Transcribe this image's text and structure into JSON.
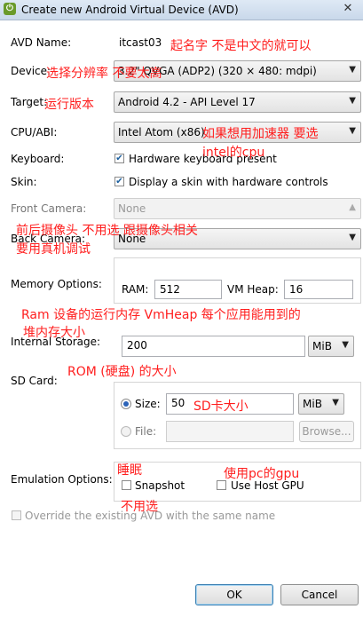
{
  "window": {
    "title": "Create new Android Virtual Device (AVD)",
    "close_glyph": "✕"
  },
  "avd_name": {
    "label": "AVD Name:",
    "value": "itcast03"
  },
  "device": {
    "label": "Device:",
    "value": "3.2\" QVGA (ADP2) (320 × 480: mdpi)"
  },
  "target": {
    "label": "Target:",
    "value": "Android 4.2 - API Level 17"
  },
  "cpu_abi": {
    "label": "CPU/ABI:",
    "value": "Intel Atom (x86)"
  },
  "keyboard": {
    "label": "Keyboard:",
    "checkbox_label": "Hardware keyboard present",
    "checked": true
  },
  "skin": {
    "label": "Skin:",
    "checkbox_label": "Display a skin with hardware controls",
    "checked": true
  },
  "front_camera": {
    "label": "Front Camera:",
    "value": "None"
  },
  "back_camera": {
    "label": "Back Camera:",
    "value": "None"
  },
  "memory": {
    "label": "Memory Options:",
    "ram_label": "RAM:",
    "ram_value": "512",
    "vmheap_label": "VM Heap:",
    "vmheap_value": "16"
  },
  "internal_storage": {
    "label": "Internal Storage:",
    "value": "200",
    "unit": "MiB"
  },
  "sd_card": {
    "label": "SD Card:",
    "size_label": "Size:",
    "size_value": "50",
    "size_unit": "MiB",
    "file_label": "File:",
    "browse_label": "Browse..."
  },
  "emulation": {
    "label": "Emulation Options:",
    "snapshot_label": "Snapshot",
    "host_gpu_label": "Use Host GPU"
  },
  "override": {
    "label": "Override the existing AVD with the same name"
  },
  "buttons": {
    "ok": "OK",
    "cancel": "Cancel"
  },
  "annotations": {
    "name_note": "起名字 不是中文的就可以",
    "device_note": "选择分辨率 不要太高",
    "target_note": "运行版本",
    "cpu_note_1": "如果想用加速器 要选",
    "cpu_note_2": "intel的cpu",
    "camera_note_1": "前后摄像头 不用选 跟摄像头相关",
    "camera_note_2": "要用真机调试",
    "ram_note_1": "Ram 设备的运行内存  VmHeap 每个应用能用到的",
    "ram_note_2": "堆内存大小",
    "rom_note": "ROM (硬盘) 的大小",
    "sd_note": "SD卡大小",
    "snapshot_note": "睡眠",
    "gpu_note": "使用pc的gpu",
    "override_note": "不用选"
  },
  "colors": {
    "annotation": "#ff1e1e",
    "accent": "#2b63b8"
  }
}
